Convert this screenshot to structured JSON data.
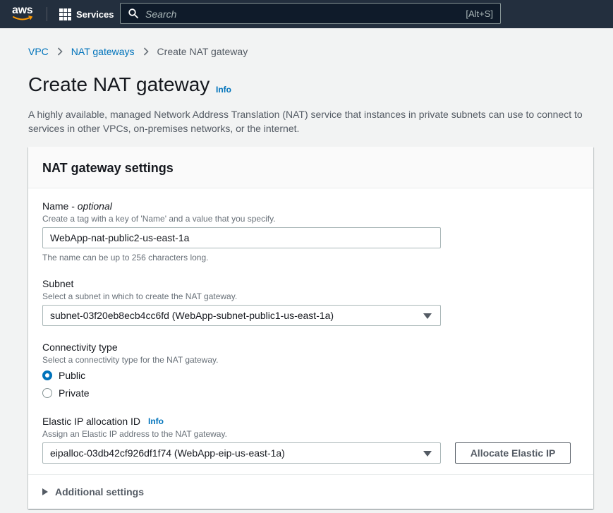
{
  "nav": {
    "logo_text": "aws",
    "services_label": "Services",
    "search_placeholder": "Search",
    "search_shortcut": "[Alt+S]"
  },
  "breadcrumb": {
    "items": [
      "VPC",
      "NAT gateways"
    ],
    "current": "Create NAT gateway"
  },
  "page": {
    "title": "Create NAT gateway",
    "info": "Info",
    "description": "A highly available, managed Network Address Translation (NAT) service that instances in private subnets can use to connect to services in other VPCs, on-premises networks, or the internet."
  },
  "panel": {
    "title": "NAT gateway settings",
    "name": {
      "label": "Name - ",
      "label_optional": "optional",
      "hint": "Create a tag with a key of 'Name' and a value that you specify.",
      "value": "WebApp-nat-public2-us-east-1a",
      "constraint": "The name can be up to 256 characters long."
    },
    "subnet": {
      "label": "Subnet",
      "hint": "Select a subnet in which to create the NAT gateway.",
      "value": "subnet-03f20eb8ecb4cc6fd (WebApp-subnet-public1-us-east-1a)"
    },
    "connectivity": {
      "label": "Connectivity type",
      "hint": "Select a connectivity type for the NAT gateway.",
      "options": [
        "Public",
        "Private"
      ],
      "selected": "Public"
    },
    "eip": {
      "label": "Elastic IP allocation ID",
      "info": "Info",
      "hint": "Assign an Elastic IP address to the NAT gateway.",
      "value": "eipalloc-03db42cf926df1f74 (WebApp-eip-us-east-1a)",
      "allocate_button": "Allocate Elastic IP"
    },
    "additional_settings": "Additional settings"
  },
  "colors": {
    "nav_bg": "#232f3e",
    "link": "#0073bb",
    "page_bg": "#f2f3f3"
  }
}
